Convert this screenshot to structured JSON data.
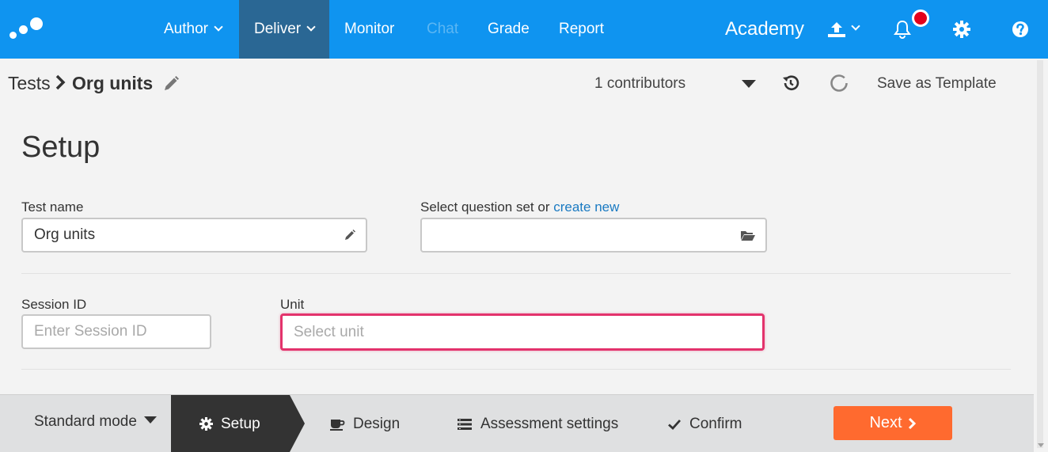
{
  "topnav": {
    "items": [
      {
        "label": "Author",
        "has_caret": true
      },
      {
        "label": "Deliver",
        "has_caret": true,
        "active": true
      },
      {
        "label": "Monitor"
      },
      {
        "label": "Chat",
        "disabled": true
      },
      {
        "label": "Grade"
      },
      {
        "label": "Report"
      }
    ],
    "org_name": "Academy",
    "icons": [
      "upload-icon",
      "bell-icon",
      "gear-icon",
      "help-icon"
    ],
    "accent_color": "#0f94f0",
    "active_color": "#2a6794"
  },
  "breadcrumb": {
    "parent": "Tests",
    "current": "Org units"
  },
  "toolbar": {
    "contributors": "1 contributors",
    "save_template": "Save as Template"
  },
  "main": {
    "title": "Setup",
    "test_name": {
      "label": "Test name",
      "value": "Org units"
    },
    "question_set": {
      "label_prefix": "Select question set or ",
      "link": "create new",
      "value": ""
    },
    "session_id": {
      "label": "Session ID",
      "placeholder": "Enter Session ID"
    },
    "unit": {
      "label": "Unit",
      "placeholder": "Select unit",
      "focus_color": "#e3336c"
    }
  },
  "bottombar": {
    "mode": "Standard mode",
    "steps": [
      {
        "label": "Setup",
        "icon": "gear-icon",
        "active": true
      },
      {
        "label": "Design",
        "icon": "cup-icon"
      },
      {
        "label": "Assessment settings",
        "icon": "list-icon"
      },
      {
        "label": "Confirm",
        "icon": "check-icon"
      }
    ],
    "next": "Next",
    "next_color": "#ff6a2f"
  }
}
